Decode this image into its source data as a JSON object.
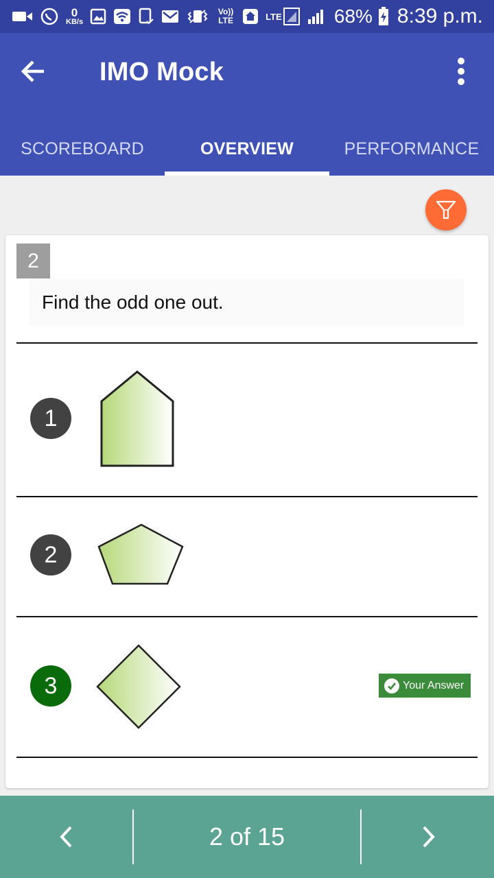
{
  "status_bar": {
    "speed_value": "0",
    "speed_unit": "KB/s",
    "volte_label": "Vo)) LTE",
    "lte_label": "LTE",
    "battery_percent": "68%",
    "time": "8:39 p.m.",
    "icons": [
      "video-icon",
      "whatsapp-icon",
      "data-speed",
      "gallery-icon",
      "wifi-icon",
      "phone-check-icon",
      "mail-icon",
      "vibrate-icon",
      "volte-icon",
      "home-icon",
      "lte-signal-icon",
      "signal-icon",
      "battery-charging-icon"
    ]
  },
  "app_bar": {
    "title": "IMO Mock",
    "back_icon": "arrow-back-icon",
    "menu_icon": "more-vert-icon"
  },
  "tabs": [
    {
      "label": "SCOREBOARD",
      "active": false
    },
    {
      "label": "OVERVIEW",
      "active": true
    },
    {
      "label": "PERFORMANCE",
      "active": false
    }
  ],
  "filter_button": {
    "icon": "filter-icon",
    "color": "#ff6b35"
  },
  "question": {
    "number": "2",
    "text": "Find the odd one out."
  },
  "options": [
    {
      "number": "1",
      "shape": "house-pentagon",
      "selected": false
    },
    {
      "number": "2",
      "shape": "regular-pentagon",
      "selected": false
    },
    {
      "number": "3",
      "shape": "diamond",
      "selected": true
    }
  ],
  "your_answer_badge": "Your Answer",
  "pagination": {
    "label": "2 of 15",
    "prev_icon": "chevron-left-icon",
    "next_icon": "chevron-right-icon"
  },
  "colors": {
    "status_bar": "#3240a0",
    "app_bar": "#3f51b5",
    "bottom_bar": "#5ba393",
    "correct_option": "#0a6b0a",
    "your_answer": "#3a8c3a"
  }
}
